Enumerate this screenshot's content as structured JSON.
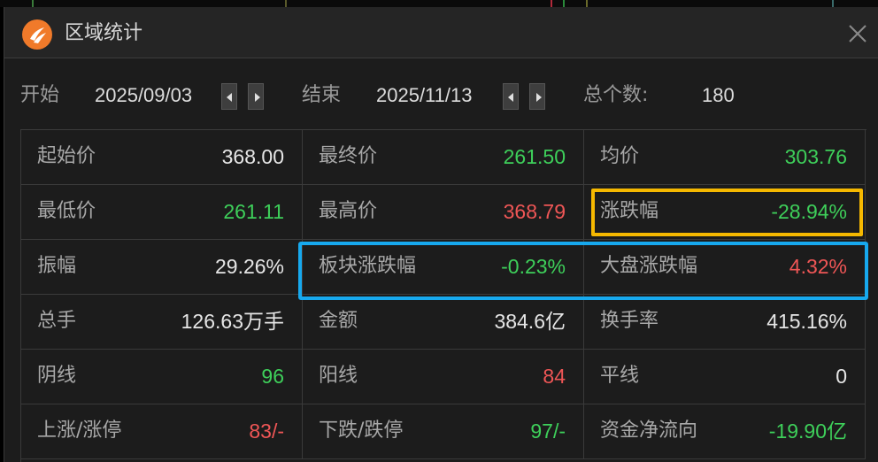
{
  "window": {
    "title": "区域统计"
  },
  "range": {
    "start_label": "开始",
    "start_date": "2025/09/03",
    "end_label": "结束",
    "end_date": "2025/11/13",
    "count_label": "总个数:",
    "count_value": "180"
  },
  "stats": [
    [
      {
        "label": "起始价",
        "value": "368.00",
        "color": "white"
      },
      {
        "label": "最终价",
        "value": "261.50",
        "color": "green"
      },
      {
        "label": "均价",
        "value": "303.76",
        "color": "green"
      }
    ],
    [
      {
        "label": "最低价",
        "value": "261.11",
        "color": "green"
      },
      {
        "label": "最高价",
        "value": "368.79",
        "color": "red"
      },
      {
        "label": "涨跌幅",
        "value": "-28.94%",
        "color": "green"
      }
    ],
    [
      {
        "label": "振幅",
        "value": "29.26%",
        "color": "white"
      },
      {
        "label": "板块涨跌幅",
        "value": "-0.23%",
        "color": "green"
      },
      {
        "label": "大盘涨跌幅",
        "value": "4.32%",
        "color": "red"
      }
    ],
    [
      {
        "label": "总手",
        "value": "126.63万手",
        "color": "white"
      },
      {
        "label": "金额",
        "value": "384.6亿",
        "color": "white"
      },
      {
        "label": "换手率",
        "value": "415.16%",
        "color": "white"
      }
    ],
    [
      {
        "label": "阴线",
        "value": "96",
        "color": "green"
      },
      {
        "label": "阳线",
        "value": "84",
        "color": "red"
      },
      {
        "label": "平线",
        "value": "0",
        "color": "white"
      }
    ],
    [
      {
        "label": "上涨/涨停",
        "value": "83/-",
        "color": "red"
      },
      {
        "label": "下跌/跌停",
        "value": "97/-",
        "color": "green"
      },
      {
        "label": "资金净流向",
        "value": "-19.90亿",
        "color": "green"
      }
    ]
  ],
  "colors": {
    "green": "#3ecf5a",
    "red": "#ef5656",
    "white": "#e6e6e6",
    "highlight_yellow": "#f5b800",
    "highlight_blue": "#17a9ee",
    "logo": "#f07a2a"
  },
  "icons": {
    "logo": "app-logo-icon",
    "close": "close-icon",
    "prev": "chevron-left-icon",
    "next": "chevron-right-icon"
  }
}
